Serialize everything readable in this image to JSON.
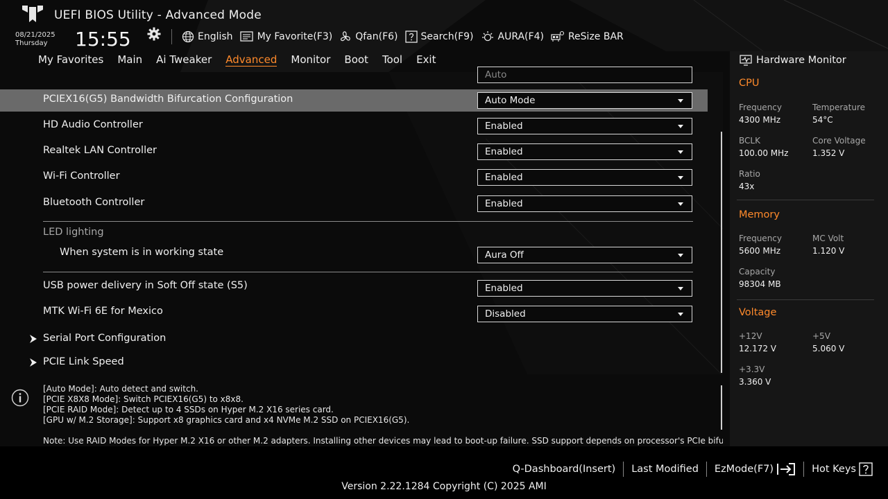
{
  "app": {
    "title": "UEFI BIOS Utility - Advanced Mode"
  },
  "status": {
    "date": "08/21/2025",
    "day": "Thursday",
    "time": "15:55"
  },
  "toolbar": {
    "language": "English",
    "favorite": "My Favorite(F3)",
    "qfan": "Qfan(F6)",
    "search": "Search(F9)",
    "aura": "AURA(F4)",
    "resize_bar": "ReSize BAR"
  },
  "tabs": [
    {
      "label": "My Favorites"
    },
    {
      "label": "Main"
    },
    {
      "label": "Ai Tweaker"
    },
    {
      "label": "Advanced"
    },
    {
      "label": "Monitor"
    },
    {
      "label": "Boot"
    },
    {
      "label": "Tool"
    },
    {
      "label": "Exit"
    }
  ],
  "active_tab": "Advanced",
  "settings": {
    "partial_value": "Auto",
    "pciex16": {
      "label": "PCIEX16(G5) Bandwidth Bifurcation Configuration",
      "value": "Auto Mode"
    },
    "hd_audio": {
      "label": "HD Audio Controller",
      "value": "Enabled"
    },
    "realtek_lan": {
      "label": "Realtek LAN Controller",
      "value": "Enabled"
    },
    "wifi": {
      "label": "Wi-Fi Controller",
      "value": "Enabled"
    },
    "bluetooth": {
      "label": "Bluetooth Controller",
      "value": "Enabled"
    },
    "led_group": "LED lighting",
    "led_working": {
      "label": "When system is in working state",
      "value": "Aura Off"
    },
    "usb_power": {
      "label": "USB power delivery in Soft Off state (S5)",
      "value": "Enabled"
    },
    "mtk_wifi": {
      "label": "MTK Wi-Fi 6E for Mexico",
      "value": "Disabled"
    },
    "serial_port": {
      "label": "Serial Port Configuration"
    },
    "pcie_link": {
      "label": "PCIE Link Speed"
    }
  },
  "help": {
    "lines": [
      "[Auto Mode]: Auto detect and switch.",
      "[PCIE X8X8 Mode]: Switch PCIEX16(G5) to x8x8.",
      "[PCIE RAID Mode]: Detect up to 4 SSDs on Hyper M.2 X16 series card.",
      "[GPU w/ M.2 Storage]: Support x8 graphics card and x4 NVMe M.2 SSD on PCIEX16(G5).",
      "",
      "Note: Use RAID Modes for Hyper M.2 X16 or other M.2 adapters. Installing other devices may lead to boot-up failure. SSD support depends on processor's PCIe bifurcation"
    ]
  },
  "hw_monitor": {
    "title": "Hardware Monitor",
    "cpu": {
      "title": "CPU",
      "frequency_label": "Frequency",
      "frequency": "4300 MHz",
      "temperature_label": "Temperature",
      "temperature": "54°C",
      "bclk_label": "BCLK",
      "bclk": "100.00 MHz",
      "core_voltage_label": "Core Voltage",
      "core_voltage": "1.352 V",
      "ratio_label": "Ratio",
      "ratio": "43x"
    },
    "memory": {
      "title": "Memory",
      "frequency_label": "Frequency",
      "frequency": "5600 MHz",
      "mc_volt_label": "MC Volt",
      "mc_volt": "1.120 V",
      "capacity_label": "Capacity",
      "capacity": "98304 MB"
    },
    "voltage": {
      "title": "Voltage",
      "v12_label": "+12V",
      "v12": "12.172 V",
      "v5_label": "+5V",
      "v5": "5.060 V",
      "v33_label": "+3.3V",
      "v33": "3.360 V"
    }
  },
  "footer": {
    "q_dashboard": "Q-Dashboard(Insert)",
    "last_modified": "Last Modified",
    "ezmode": "EzMode(F7)",
    "hot_keys": "Hot Keys",
    "version": "Version 2.22.1284 Copyright (C) 2025 AMI"
  },
  "colors": {
    "accent": "#ff8a2b",
    "selected_row": "#6a6a6a",
    "panel": "#161616"
  }
}
